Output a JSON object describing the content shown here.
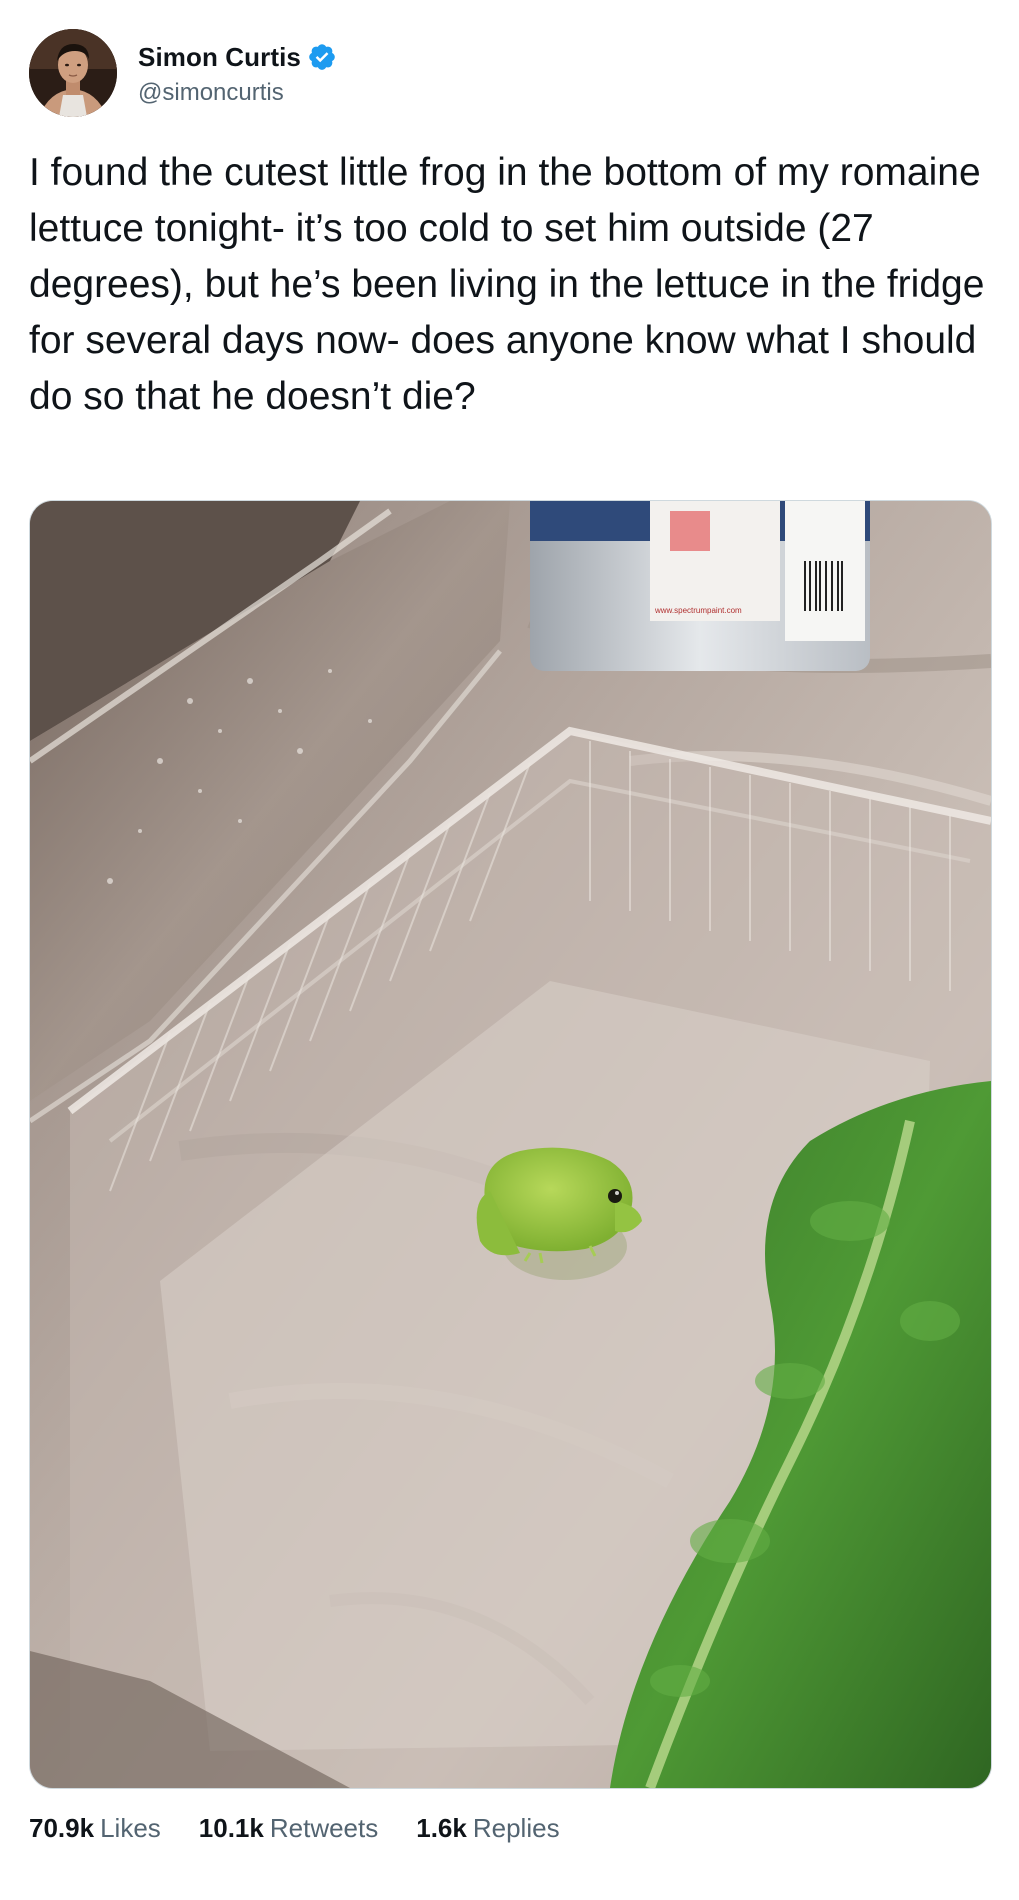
{
  "author": {
    "display_name": "Simon Curtis",
    "handle": "@simoncurtis",
    "verified": true,
    "verified_badge_color": "#1d9bf0"
  },
  "tweet": {
    "text": "I found the cutest little frog in the bottom of my romaine lettuce tonight- it’s too cold to set him outside (27 degrees), but he’s been living in the lettuce in the fridge for several days now- does anyone know what I should do so that he doesn’t die?"
  },
  "media": {
    "photo_subject": "small green frog in an empty clear plastic lettuce container next to a romaine leaf",
    "can_label_url": "www.spectrumpaint.com"
  },
  "stats": {
    "likes_value": "70.9k",
    "likes_label": "Likes",
    "retweets_value": "10.1k",
    "retweets_label": "Retweets",
    "replies_value": "1.6k",
    "replies_label": "Replies"
  },
  "colors": {
    "text_primary": "#0f1419",
    "text_secondary": "#536471",
    "border": "#cfd9de",
    "accent": "#1d9bf0"
  }
}
